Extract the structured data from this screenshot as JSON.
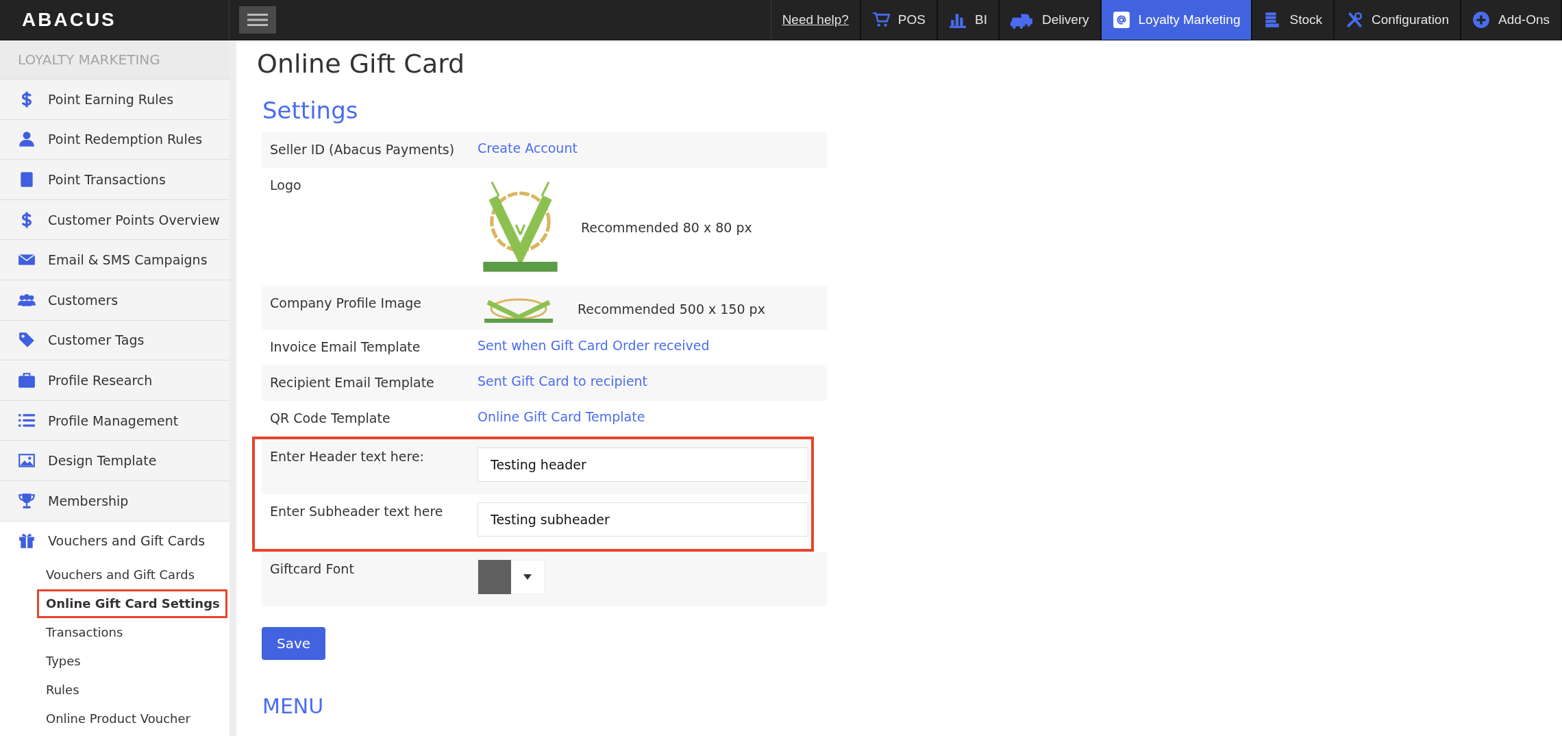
{
  "brand": "ABACUS",
  "top_nav": [
    {
      "label": "Need help?",
      "kind": "link",
      "selected": false
    },
    {
      "label": "POS",
      "kind": "module",
      "selected": false
    },
    {
      "label": "BI",
      "kind": "module",
      "selected": false
    },
    {
      "label": "Delivery",
      "kind": "module",
      "selected": false
    },
    {
      "label": "Loyalty Marketing",
      "kind": "module",
      "selected": true
    },
    {
      "label": "Stock",
      "kind": "module",
      "selected": false
    },
    {
      "label": "Configuration",
      "kind": "module",
      "selected": false
    },
    {
      "label": "Add-Ons",
      "kind": "module",
      "selected": false
    }
  ],
  "sidebar": {
    "heading": "LOYALTY MARKETING",
    "items": [
      {
        "label": "Point Earning Rules"
      },
      {
        "label": "Point Redemption Rules"
      },
      {
        "label": "Point Transactions"
      },
      {
        "label": "Customer Points Overview"
      },
      {
        "label": "Email & SMS Campaigns"
      },
      {
        "label": "Customers"
      },
      {
        "label": "Customer Tags"
      },
      {
        "label": "Profile Research"
      },
      {
        "label": "Profile Management"
      },
      {
        "label": "Design Template"
      },
      {
        "label": "Membership"
      },
      {
        "label": "Vouchers and Gift Cards",
        "children": [
          {
            "label": "Vouchers and Gift Cards",
            "selected": false,
            "highlighted": false
          },
          {
            "label": "Online Gift Card Settings",
            "selected": true,
            "highlighted": true
          },
          {
            "label": "Transactions",
            "selected": false,
            "highlighted": false
          },
          {
            "label": "Types",
            "selected": false,
            "highlighted": false
          },
          {
            "label": "Rules",
            "selected": false,
            "highlighted": false
          },
          {
            "label": "Online Product Voucher",
            "selected": false,
            "highlighted": false
          }
        ]
      }
    ]
  },
  "page_title": "Online Gift Card",
  "settings": {
    "heading": "Settings",
    "rows": [
      {
        "kind": "link",
        "label": "Seller ID (Abacus Payments)",
        "link": "Create Account",
        "highlighted": false
      },
      {
        "kind": "image",
        "label": "Logo",
        "note": "Recommended 80 x 80 px",
        "highlighted": false
      },
      {
        "kind": "banner",
        "label": "Company Profile Image",
        "note": "Recommended 500 x 150 px",
        "highlighted": false
      },
      {
        "kind": "link",
        "label": "Invoice Email Template",
        "link": "Sent when Gift Card Order received",
        "highlighted": false
      },
      {
        "kind": "link",
        "label": "Recipient Email Template",
        "link": "Sent Gift Card to recipient",
        "highlighted": false
      },
      {
        "kind": "link",
        "label": "QR Code Template",
        "link": "Online Gift Card Template",
        "highlighted": false
      },
      {
        "kind": "input",
        "label": "Enter Header text here:",
        "value": "Testing header",
        "highlighted": true
      },
      {
        "kind": "input",
        "label": "Enter Subheader text here",
        "value": "Testing subheader",
        "highlighted": true
      },
      {
        "kind": "color",
        "label": "Giftcard Font",
        "color": "#606060",
        "highlighted": false
      }
    ]
  },
  "save_button": "Save",
  "menu_heading": "MENU"
}
